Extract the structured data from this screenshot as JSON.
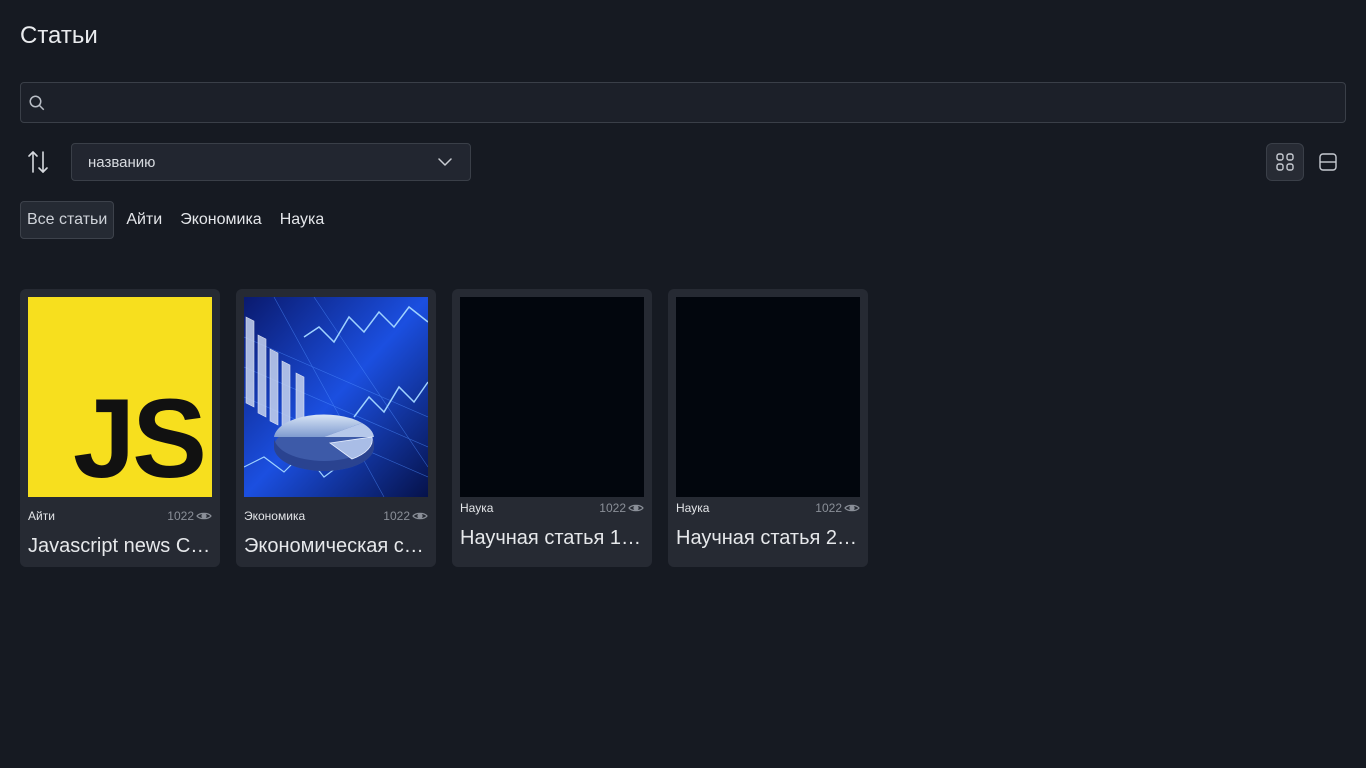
{
  "page": {
    "title": "Статьи"
  },
  "search": {
    "value": "",
    "placeholder": ""
  },
  "sort": {
    "selected": "названию"
  },
  "tabs": [
    {
      "label": "Все статьи",
      "active": true
    },
    {
      "label": "Айти",
      "active": false
    },
    {
      "label": "Экономика",
      "active": false
    },
    {
      "label": "Наука",
      "active": false
    }
  ],
  "view_modes": {
    "selected": "grid",
    "icons": [
      "grid-view-icon",
      "list-view-icon"
    ]
  },
  "articles": [
    {
      "tag": "Айти",
      "views": "1022",
      "title": "Javascript news C…",
      "image": "js-logo-image"
    },
    {
      "tag": "Экономика",
      "views": "1022",
      "title": "Экономическая с…",
      "image": "economy-chart-image"
    },
    {
      "tag": "Наука",
      "views": "1022",
      "title": "Научная статья 1…",
      "image": "black-image"
    },
    {
      "tag": "Наука",
      "views": "1022",
      "title": "Научная статья 2…",
      "image": "black-image"
    }
  ],
  "colors": {
    "background": "#161a22",
    "card": "#262a33",
    "border": "#3a3f48",
    "js_yellow": "#f7df1e"
  }
}
